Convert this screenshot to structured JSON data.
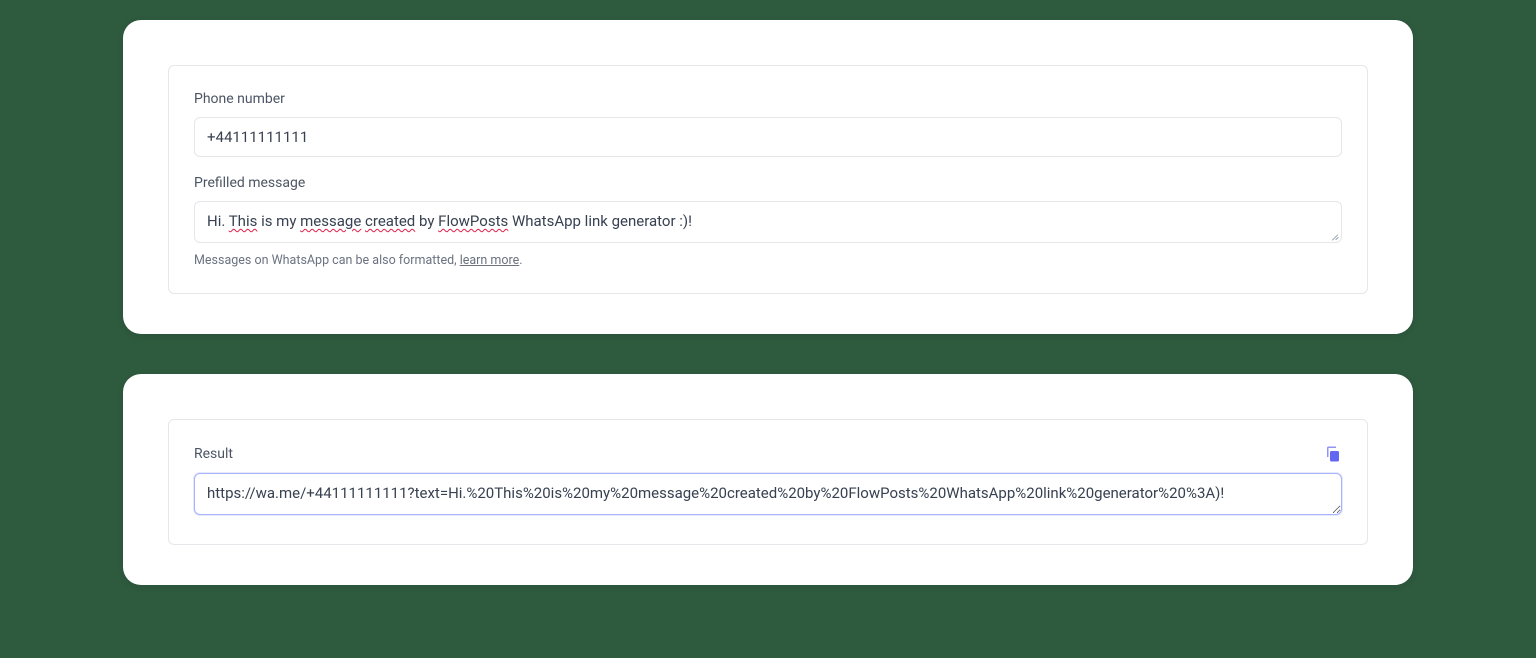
{
  "form": {
    "phone": {
      "label": "Phone number",
      "value": "+44111111111"
    },
    "message": {
      "label": "Prefilled message",
      "parts": {
        "p1": "Hi. ",
        "p2": "This",
        "p3": " is my ",
        "p4": "message",
        "p5": " ",
        "p6": "created",
        "p7": " by ",
        "p8": "FlowPosts",
        "p9": " WhatsApp link generator :)!"
      },
      "help_prefix": "Messages on WhatsApp can be also formatted, ",
      "help_link": "learn more",
      "help_suffix": "."
    }
  },
  "result": {
    "label": "Result",
    "value": "https://wa.me/+44111111111?text=Hi.%20This%20is%20my%20message%20created%20by%20FlowPosts%20WhatsApp%20link%20generator%20%3A)!"
  }
}
